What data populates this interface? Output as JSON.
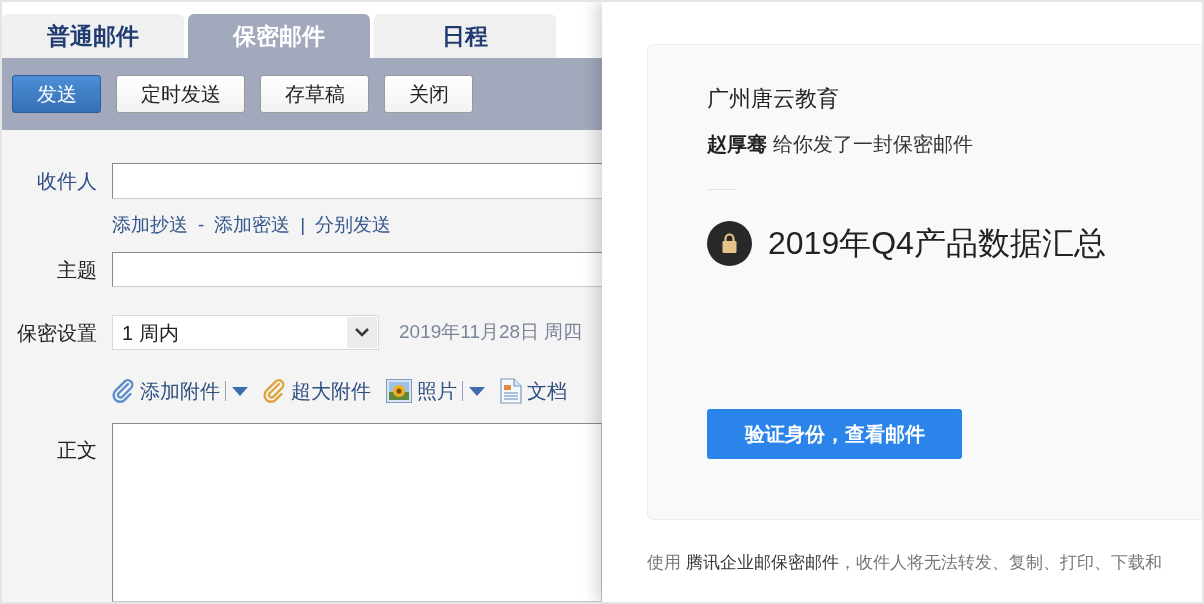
{
  "compose": {
    "tabs": [
      {
        "label": "普通邮件",
        "selected": false
      },
      {
        "label": "保密邮件",
        "selected": true
      },
      {
        "label": "日程",
        "selected": false
      }
    ],
    "toolbar": [
      {
        "label": "发送",
        "kind": "primary"
      },
      {
        "label": "定时发送",
        "kind": "secondary"
      },
      {
        "label": "存草稿",
        "kind": "secondary"
      },
      {
        "label": "关闭",
        "kind": "secondary"
      }
    ],
    "recipient": {
      "label": "收件人",
      "options": [
        {
          "kind": "link",
          "text": "添加抄送"
        },
        {
          "kind": "separator",
          "text": "-"
        },
        {
          "kind": "link",
          "text": "添加密送"
        },
        {
          "kind": "separator",
          "text": "|"
        },
        {
          "kind": "link",
          "text": "分别发送"
        }
      ]
    },
    "subject": {
      "label": "主题"
    },
    "security": {
      "label": "保密设置",
      "value": "1 周内",
      "expiry": "2019年11月28日 周四"
    },
    "attachments": [
      {
        "kind": "attachment",
        "label": "添加附件",
        "dropdown": true
      },
      {
        "kind": "large",
        "label": "超大附件",
        "dropdown": false
      },
      {
        "kind": "photo",
        "label": "照片",
        "dropdown": true
      },
      {
        "kind": "document",
        "label": "文档",
        "dropdown": false
      }
    ],
    "body": {
      "label": "正文"
    }
  },
  "preview": {
    "company": "广州唐云教育",
    "message": "**赵厚骞** 给你发了一封保密邮件",
    "title": "2019年Q4产品数据汇总",
    "button": "验证身份，查看邮件",
    "footer": "使用 **腾讯企业邮保密邮件**，收件人将无法转发、复制、打印、下载和"
  }
}
